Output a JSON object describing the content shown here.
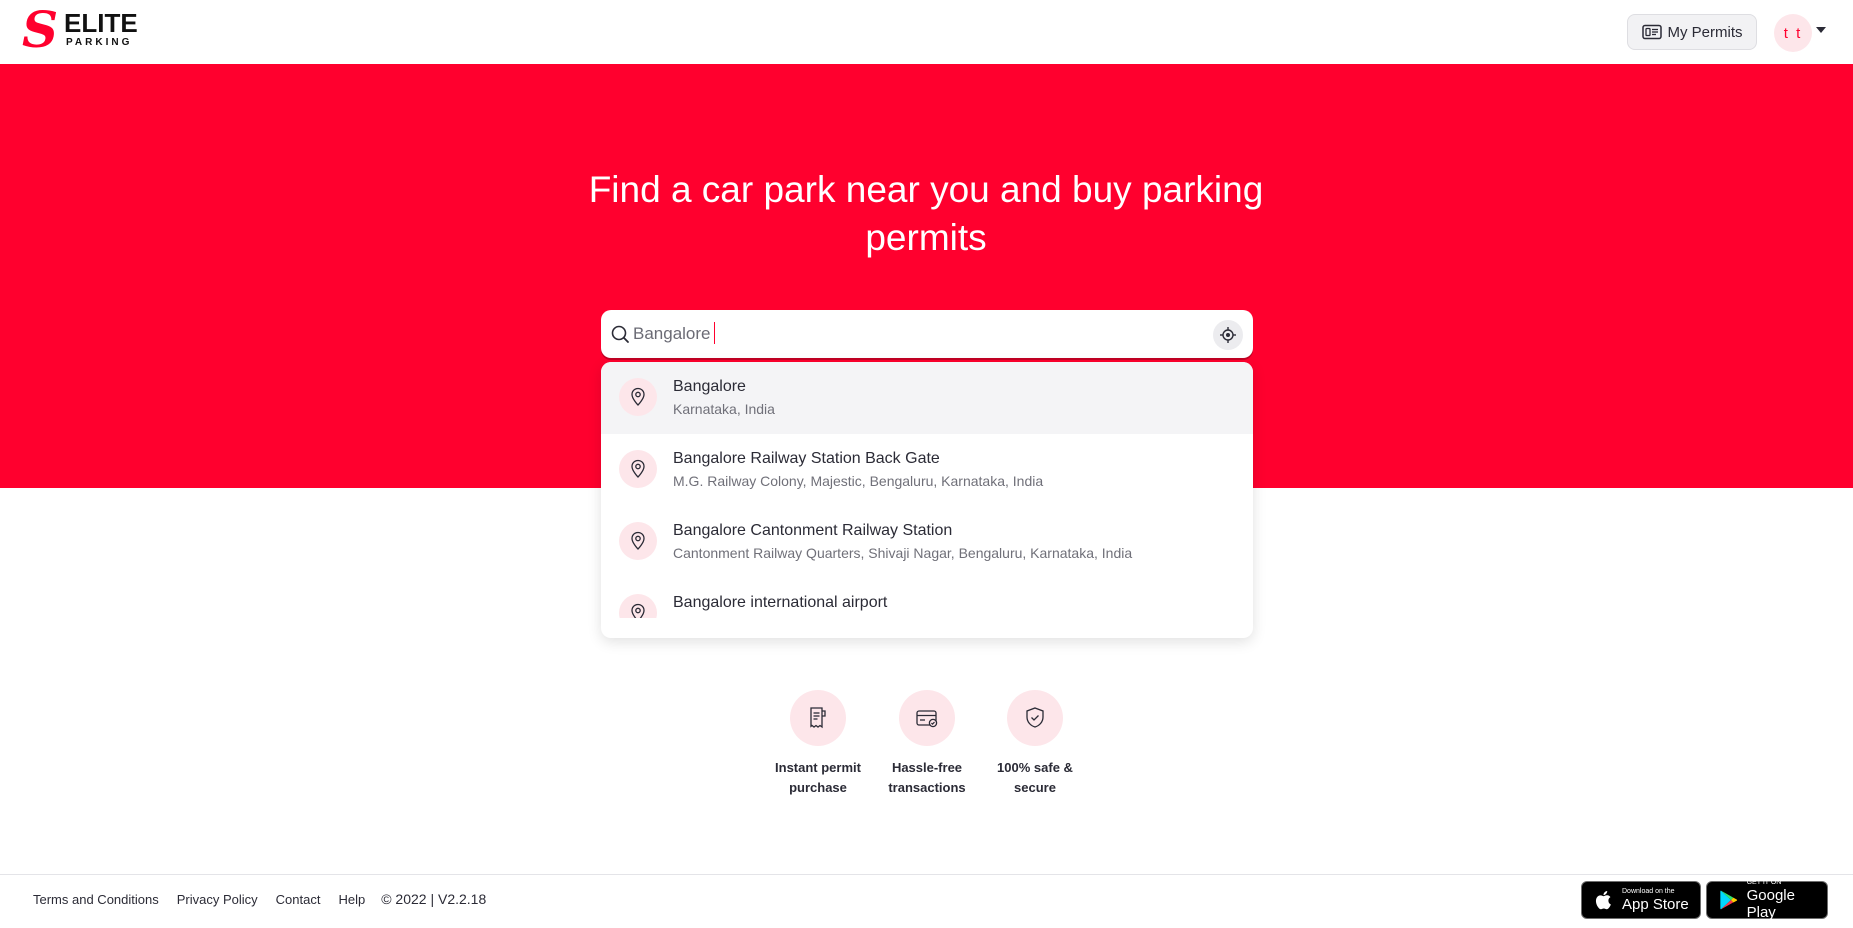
{
  "brand": {
    "logo_top": "ELITE",
    "logo_bottom": "PARKING",
    "logo_mark": "S",
    "accent_color": "#ff002e"
  },
  "header": {
    "my_permits_label": "My Permits",
    "my_permits_icon": "permit-card-icon",
    "avatar_initials": "t t"
  },
  "hero": {
    "title": "Find a car park near you and buy parking permits"
  },
  "search": {
    "value": "Bangalore",
    "search_icon": "search-icon",
    "locate_icon": "crosshair-location-icon"
  },
  "suggestions": [
    {
      "title": "Bangalore",
      "subtitle": "Karnataka, India",
      "icon": "map-pin-icon"
    },
    {
      "title": "Bangalore Railway Station Back Gate",
      "subtitle": "M.G. Railway Colony, Majestic, Bengaluru, Karnataka, India",
      "icon": "map-pin-icon"
    },
    {
      "title": "Bangalore Cantonment Railway Station",
      "subtitle": "Cantonment Railway Quarters, Shivaji Nagar, Bengaluru, Karnataka, India",
      "icon": "map-pin-icon"
    },
    {
      "title": "Bangalore international airport",
      "subtitle": "",
      "icon": "map-pin-icon"
    }
  ],
  "features": [
    {
      "label": "Instant permit purchase",
      "icon": "receipt-icon"
    },
    {
      "label": "Hassle-free transactions",
      "icon": "card-check-icon"
    },
    {
      "label": "100% safe & secure",
      "icon": "shield-check-icon"
    }
  ],
  "footer": {
    "links": [
      "Terms and Conditions",
      "Privacy Policy",
      "Contact",
      "Help"
    ],
    "copyright": "© 2022 | V2.2.18",
    "app_store_small": "Download on the",
    "app_store_big": "App Store",
    "google_play_small": "GET IT ON",
    "google_play_big": "Google Play"
  }
}
